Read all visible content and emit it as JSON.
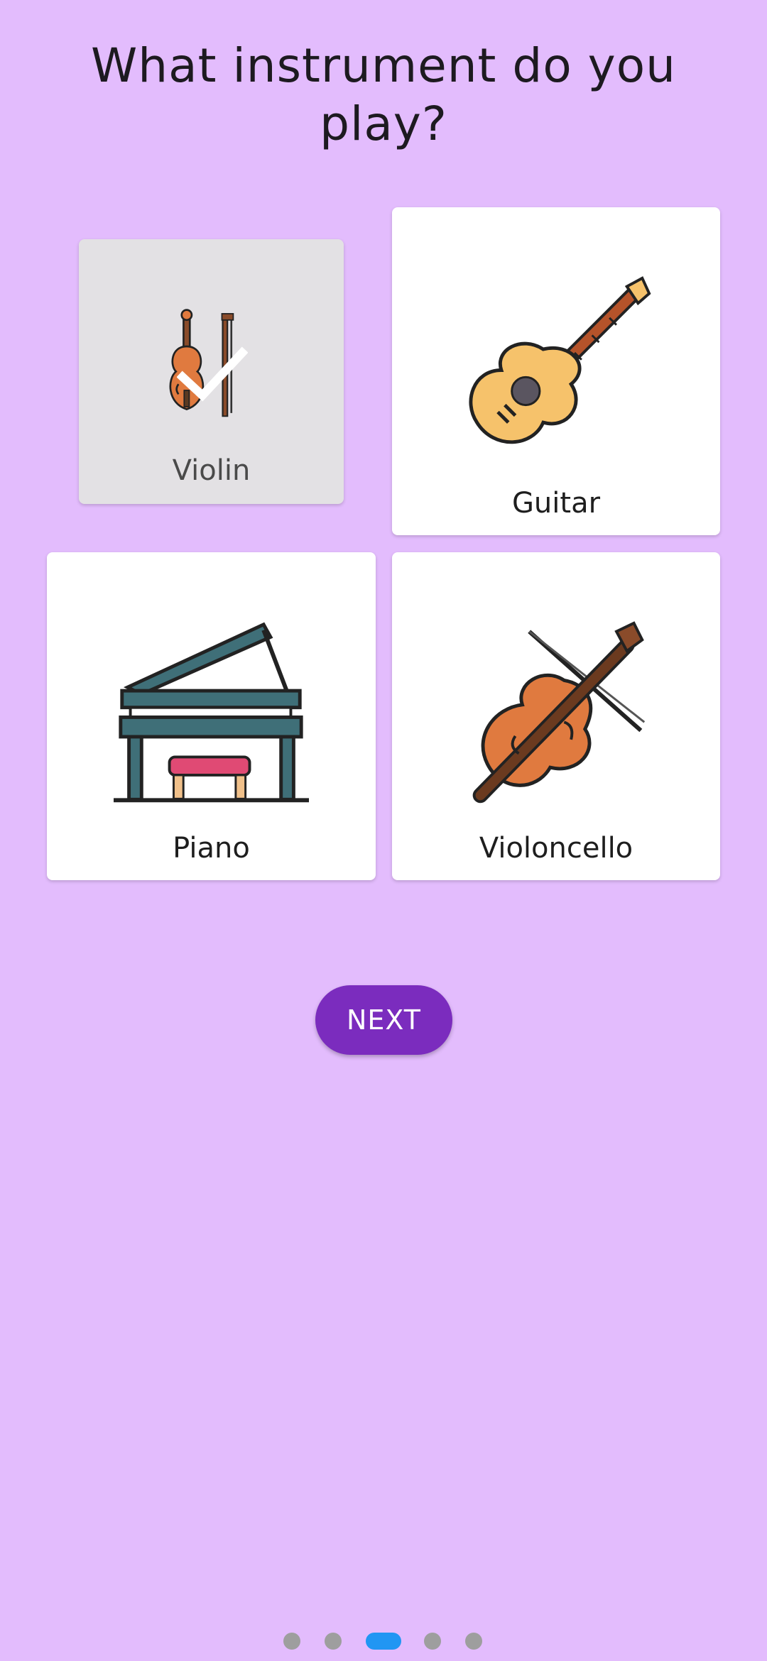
{
  "onboarding": {
    "title": "What instrument do you play?",
    "next_label": "NEXT"
  },
  "instruments": [
    {
      "label": "Violin",
      "icon": "violin-icon",
      "selected": true
    },
    {
      "label": "Guitar",
      "icon": "guitar-icon",
      "selected": false
    },
    {
      "label": "Piano",
      "icon": "piano-icon",
      "selected": false
    },
    {
      "label": "Violoncello",
      "icon": "cello-icon",
      "selected": false
    }
  ],
  "pager": {
    "page_count": 5,
    "current_page": 3
  },
  "colors": {
    "background": "#e3bcfd",
    "accent": "#7b2cbe",
    "pager_active": "#2196f3",
    "pager_inactive": "#9e9e9e",
    "selected_card": "#e3e1e4"
  }
}
